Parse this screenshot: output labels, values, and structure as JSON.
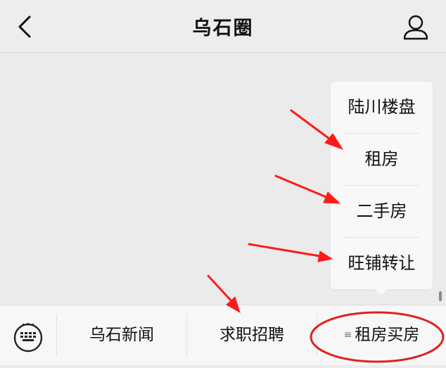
{
  "header": {
    "title": "乌石圈",
    "back_icon": "chevron-left-icon",
    "profile_icon": "person-icon"
  },
  "popup_menu": {
    "items": [
      "陆川楼盘",
      "租房",
      "二手房",
      "旺铺转让"
    ]
  },
  "bottom_menu": {
    "keyboard_icon": "keyboard-icon",
    "tabs": [
      {
        "label": "乌石新闻"
      },
      {
        "label": "求职招聘"
      },
      {
        "label": "租房买房",
        "icon": "list-icon",
        "icon_glyph": "≡"
      }
    ]
  },
  "annotations": {
    "arrow_color": "#ff1a1a",
    "ellipse_color": "#e0201e"
  }
}
